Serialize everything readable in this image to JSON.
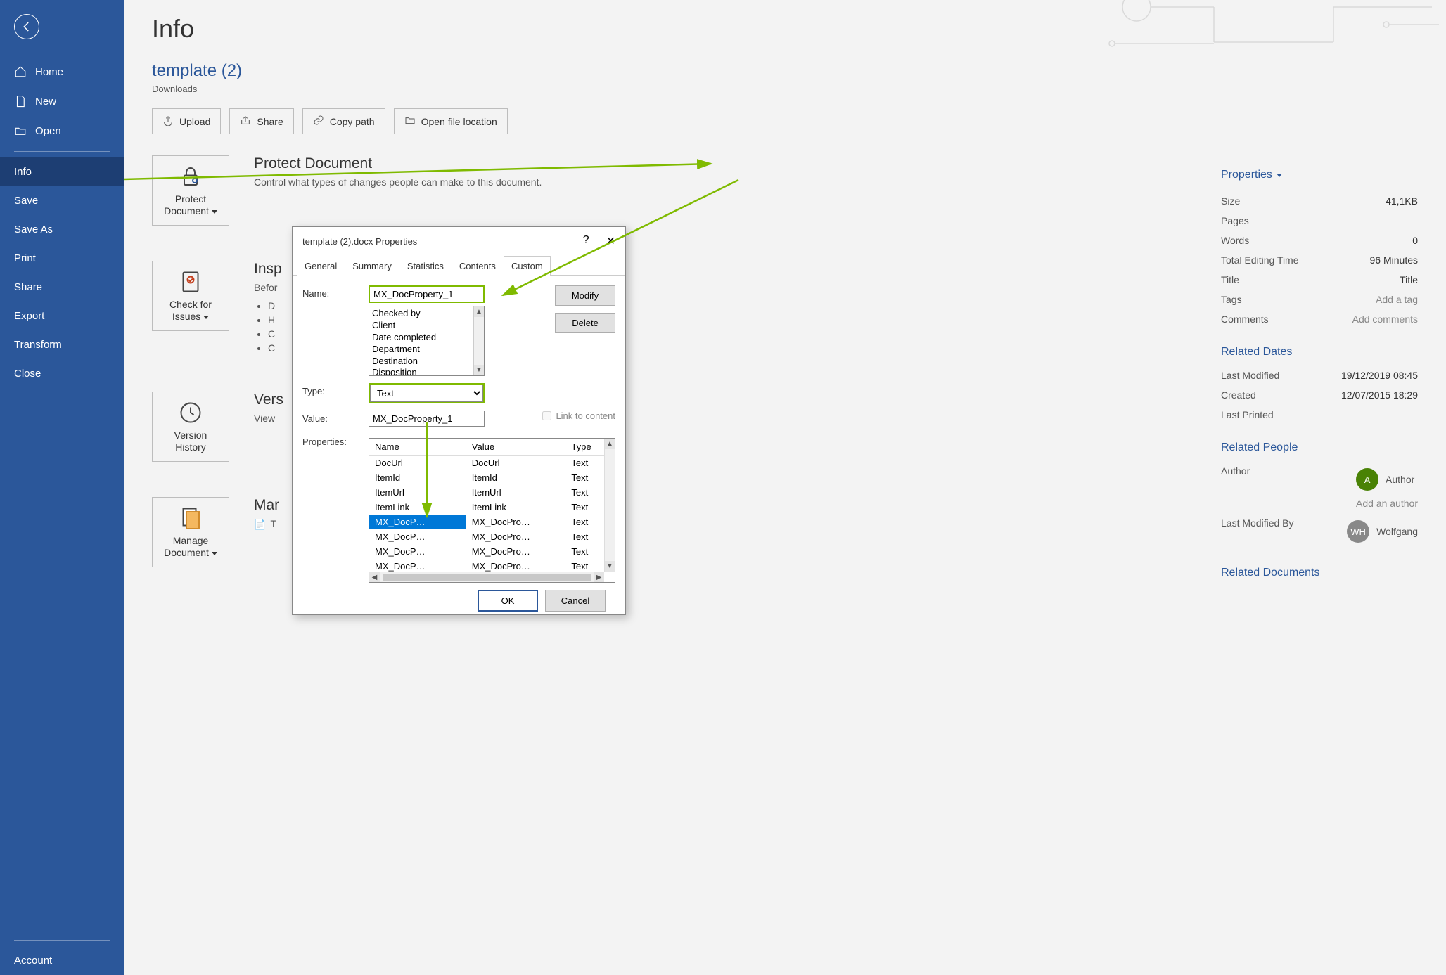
{
  "sidebar": {
    "items": [
      {
        "label": "Home"
      },
      {
        "label": "New"
      },
      {
        "label": "Open"
      },
      {
        "label": "Info",
        "active": true
      },
      {
        "label": "Save"
      },
      {
        "label": "Save As"
      },
      {
        "label": "Print"
      },
      {
        "label": "Share"
      },
      {
        "label": "Export"
      },
      {
        "label": "Transform"
      },
      {
        "label": "Close"
      }
    ],
    "account": "Account"
  },
  "page": {
    "title": "Info",
    "doc_name": "template (2)",
    "doc_location": "Downloads",
    "actions": {
      "upload": "Upload",
      "share": "Share",
      "copy_path": "Copy path",
      "open_location": "Open file location"
    },
    "sections": {
      "protect": {
        "tile": "Protect Document",
        "heading": "Protect Document",
        "desc": "Control what types of changes people can make to this document."
      },
      "inspect": {
        "tile": "Check for Issues",
        "heading": "Insp",
        "desc": "Befor",
        "bullets": [
          "D",
          "H",
          "C",
          "C"
        ]
      },
      "version": {
        "tile": "Version History",
        "heading": "Vers",
        "desc": "View"
      },
      "manage": {
        "tile": "Manage Document",
        "heading": "Mar",
        "desc": "T"
      }
    }
  },
  "properties": {
    "header": "Properties",
    "rows": {
      "size": {
        "label": "Size",
        "value": "41,1KB"
      },
      "pages": {
        "label": "Pages",
        "value": ""
      },
      "words": {
        "label": "Words",
        "value": "0"
      },
      "editing_time": {
        "label": "Total Editing Time",
        "value": "96 Minutes"
      },
      "title": {
        "label": "Title",
        "value": "Title"
      },
      "tags": {
        "label": "Tags",
        "value": "Add a tag",
        "placeholder": true
      },
      "comments": {
        "label": "Comments",
        "value": "Add comments",
        "placeholder": true
      }
    },
    "related_dates": {
      "header": "Related Dates",
      "last_modified": {
        "label": "Last Modified",
        "value": "19/12/2019 08:45"
      },
      "created": {
        "label": "Created",
        "value": "12/07/2015 18:29"
      },
      "last_printed": {
        "label": "Last Printed",
        "value": ""
      }
    },
    "related_people": {
      "header": "Related People",
      "author_label": "Author",
      "author_name": "Author",
      "author_initials": "A",
      "add_author": "Add an author",
      "last_modified_by_label": "Last Modified By",
      "last_modified_by_name": "Wolfgang",
      "last_modified_by_initials": "WH"
    },
    "related_docs_header": "Related Documents"
  },
  "dialog": {
    "title": "template (2).docx Properties",
    "tabs": [
      "General",
      "Summary",
      "Statistics",
      "Contents",
      "Custom"
    ],
    "active_tab": "Custom",
    "labels": {
      "name": "Name:",
      "type": "Type:",
      "value": "Value:",
      "properties": "Properties:",
      "link_to_content": "Link to content",
      "modify": "Modify",
      "delete": "Delete",
      "ok": "OK",
      "cancel": "Cancel"
    },
    "name_value": "MX_DocProperty_1",
    "name_suggestions": [
      "Checked by",
      "Client",
      "Date completed",
      "Department",
      "Destination",
      "Disposition"
    ],
    "type_value": "Text",
    "value_value": "MX_DocProperty_1",
    "table_headers": [
      "Name",
      "Value",
      "Type"
    ],
    "table_rows": [
      {
        "name": "DocUrl",
        "value": "DocUrl",
        "type": "Text"
      },
      {
        "name": "ItemId",
        "value": "ItemId",
        "type": "Text"
      },
      {
        "name": "ItemUrl",
        "value": "ItemUrl",
        "type": "Text"
      },
      {
        "name": "ItemLink",
        "value": "ItemLink",
        "type": "Text"
      },
      {
        "name": "MX_DocP…",
        "value": "MX_DocPro…",
        "type": "Text",
        "selected": true
      },
      {
        "name": "MX_DocP…",
        "value": "MX_DocPro…",
        "type": "Text"
      },
      {
        "name": "MX_DocP…",
        "value": "MX_DocPro…",
        "type": "Text"
      },
      {
        "name": "MX_DocP…",
        "value": "MX_DocPro…",
        "type": "Text"
      }
    ]
  }
}
